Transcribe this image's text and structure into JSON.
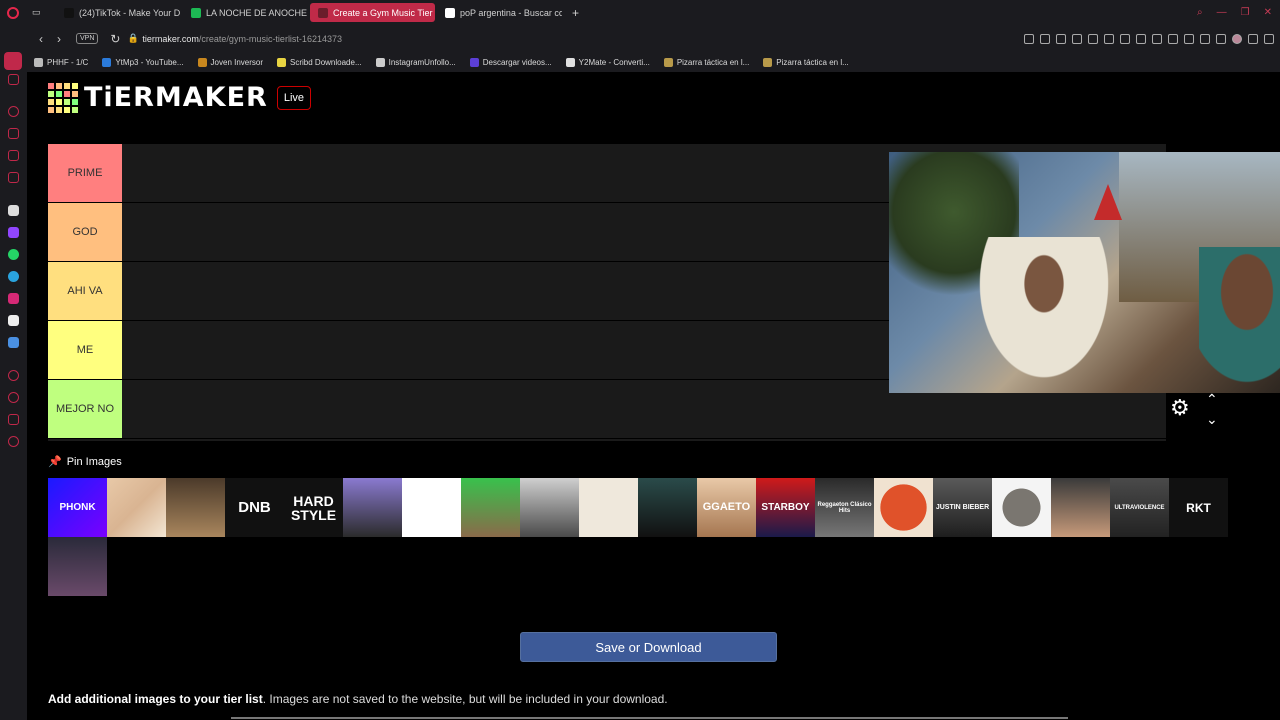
{
  "browser": {
    "tabs": [
      {
        "label": "(24)TikTok - Make Your D",
        "color": "#111111"
      },
      {
        "label": "LA NOCHE DE ANOCHE",
        "color": "#1db954"
      },
      {
        "label": "Create a Gym Music Tier",
        "color": "#6b1d2b",
        "active": true
      },
      {
        "label": "poP argentina - Buscar co",
        "color": "#ffffff"
      }
    ],
    "new_tab": "+",
    "url_host": "tiermaker.com",
    "url_path": "/create/gym-music-tierlist-16214373",
    "vpn": "VPN",
    "bookmarks": [
      {
        "label": "PHHF - 1/C",
        "color": "#bbbbbb"
      },
      {
        "label": "YtMp3 - YouTube...",
        "color": "#2b7bdb"
      },
      {
        "label": "Joven Inversor",
        "color": "#c8871e"
      },
      {
        "label": "Scribd Downloade...",
        "color": "#e8d442"
      },
      {
        "label": "InstagramUnfollo...",
        "color": "#cccccc"
      },
      {
        "label": "Descargar videos...",
        "color": "#5c3fd6"
      },
      {
        "label": "Y2Mate - Converti...",
        "color": "#e0e0e0"
      },
      {
        "label": "Pizarra táctica en l...",
        "color": "#b89a4a"
      },
      {
        "label": "Pizarra táctica en l...",
        "color": "#b89a4a"
      }
    ]
  },
  "site": {
    "logo_text": "TiERMAKER",
    "live_label": "Live",
    "logo_colors": [
      "#ff7f7f",
      "#ffbf7f",
      "#ffdf7f",
      "#ffff7f",
      "#bfff7f",
      "#7fff7f",
      "#ff7f7f",
      "#ffbf7f",
      "#ffdf7f",
      "#ffff7f",
      "#bfff7f",
      "#7fff7f",
      "#ffbf7f",
      "#ffdf7f",
      "#ffff7f",
      "#bfff7f"
    ]
  },
  "tiers": [
    {
      "label": "PRIME",
      "color": "#ff7f7f"
    },
    {
      "label": "GOD",
      "color": "#ffbf7f"
    },
    {
      "label": "AHI VA",
      "color": "#ffdf7f"
    },
    {
      "label": "ME",
      "color": "#ffff7f"
    },
    {
      "label": "MEJOR NO",
      "color": "#bfff7f"
    }
  ],
  "controls": {
    "gear": "⚙",
    "up": "⌃",
    "down": "⌄"
  },
  "pin_label": "Pin Images",
  "pin_icon": "📌",
  "images_row1": [
    {
      "name": "phonk",
      "text": "PHONK",
      "bg": "linear-gradient(135deg,#1a1aff,#7a00ff)",
      "fg": "#fff",
      "size": 10
    },
    {
      "name": "pop-collage",
      "text": "",
      "bg": "linear-gradient(135deg,#e8c9a8,#d9b492,#f3e6d3)",
      "fg": "#000",
      "size": 9
    },
    {
      "name": "bodybuilder",
      "text": "",
      "bg": "linear-gradient(180deg,#4b3a2a,#a9865d)",
      "fg": "#000",
      "size": 9
    },
    {
      "name": "dnb",
      "text": "DNB",
      "bg": "#111",
      "fg": "#fff",
      "size": 15
    },
    {
      "name": "hardstyle",
      "text": "HARD STYLE",
      "bg": "#111",
      "fg": "#fff",
      "size": 14
    },
    {
      "name": "group-photo",
      "text": "",
      "bg": "linear-gradient(180deg,#8a7ad0,#2b2b2b)",
      "fg": "#fff",
      "size": 9
    },
    {
      "name": "no-headphones",
      "text": "",
      "bg": "#ffffff",
      "fg": "#d00",
      "size": 9
    },
    {
      "name": "man-green",
      "text": "",
      "bg": "linear-gradient(180deg,#38c14c,#8a6a4a)",
      "fg": "#fff",
      "size": 9
    },
    {
      "name": "band-photo",
      "text": "",
      "bg": "linear-gradient(180deg,#cfcfcf,#4a4a4a)",
      "fg": "#fff",
      "size": 9
    },
    {
      "name": "cartoon",
      "text": "",
      "bg": "#efe8dc",
      "fg": "#000",
      "size": 9
    },
    {
      "name": "crowd",
      "text": "",
      "bg": "linear-gradient(180deg,#2a4b4a,#111)",
      "fg": "#fff",
      "size": 9
    },
    {
      "name": "ggaeto",
      "text": "GGAETO",
      "bg": "linear-gradient(180deg,#e9c9a8,#a57650)",
      "fg": "#fff",
      "size": 11
    },
    {
      "name": "starboy",
      "text": "STARBOY",
      "bg": "linear-gradient(180deg,#d01a1a,#1a1a4a)",
      "fg": "#fff",
      "size": 10
    },
    {
      "name": "reggaeton",
      "text": "Reggaeton Clásico Hits",
      "bg": "linear-gradient(180deg,#2a2a2a,#777)",
      "fg": "#fff",
      "size": 6
    },
    {
      "name": "soup",
      "text": "",
      "bg": "radial-gradient(circle,#e0522a 0 55%,#f0e2d0 56%)",
      "fg": "#000",
      "size": 9
    },
    {
      "name": "justin-bieber",
      "text": "JUSTIN BIEBER",
      "bg": "linear-gradient(180deg,#5a5a5a,#1e1e1e)",
      "fg": "#fff",
      "size": 7
    },
    {
      "name": "rock",
      "text": "",
      "bg": "radial-gradient(ellipse,#7a7670 0 45%,#f4f4f4 46%)",
      "fg": "#000",
      "size": 9
    },
    {
      "name": "man-smile",
      "text": "",
      "bg": "linear-gradient(180deg,#3a3a3a,#c79a7a)",
      "fg": "#fff",
      "size": 9
    },
    {
      "name": "ultraviolence",
      "text": "ULTRAVIOLENCE",
      "bg": "linear-gradient(180deg,#4a4a4a,#222)",
      "fg": "#fff",
      "size": 6
    },
    {
      "name": "rkt",
      "text": "RKT",
      "bg": "#111",
      "fg": "#fff",
      "size": 12
    }
  ],
  "images_row2": [
    {
      "name": "movie-poster",
      "text": "",
      "bg": "linear-gradient(180deg,#2a2a3a,#6a4a6a)",
      "fg": "#fff",
      "size": 9
    }
  ],
  "save_label": "Save or Download",
  "add_title": "Add additional images to your tier list",
  "add_text": ". Images are not saved to the website, but will be included in your download."
}
